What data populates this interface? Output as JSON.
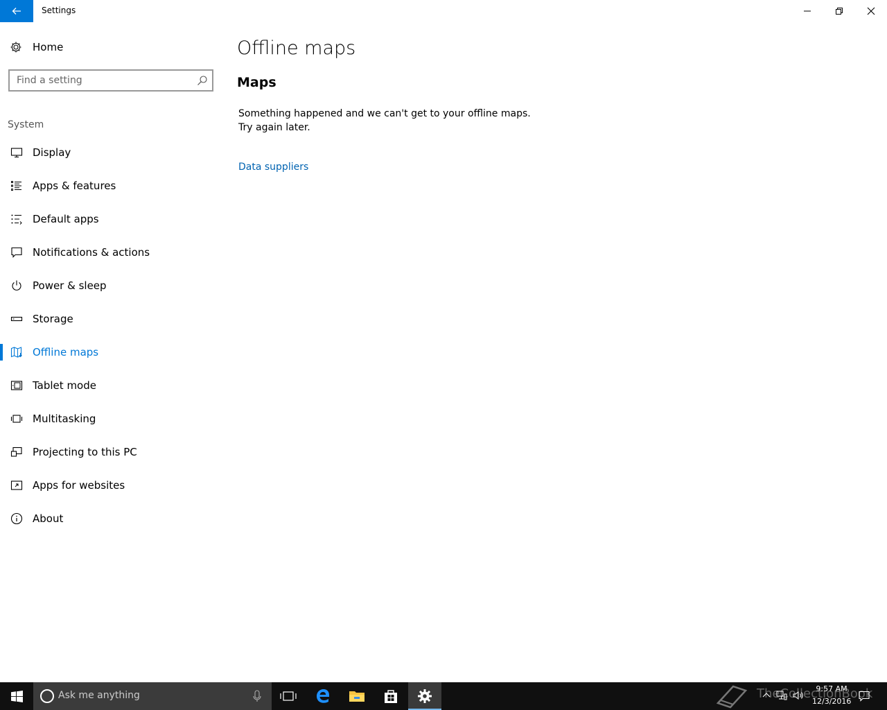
{
  "window": {
    "title": "Settings",
    "back_icon": "arrow-left-icon",
    "controls": [
      "minimize-icon",
      "maximize-icon",
      "close-icon"
    ]
  },
  "sidebar": {
    "home_label": "Home",
    "search_placeholder": "Find a setting",
    "section": "System",
    "items": [
      {
        "label": "Display",
        "icon": "display-icon",
        "active": false
      },
      {
        "label": "Apps & features",
        "icon": "apps-list-icon",
        "active": false
      },
      {
        "label": "Default apps",
        "icon": "default-apps-icon",
        "active": false
      },
      {
        "label": "Notifications & actions",
        "icon": "notifications-icon",
        "active": false
      },
      {
        "label": "Power & sleep",
        "icon": "power-icon",
        "active": false
      },
      {
        "label": "Storage",
        "icon": "storage-icon",
        "active": false
      },
      {
        "label": "Offline maps",
        "icon": "map-icon",
        "active": true
      },
      {
        "label": "Tablet mode",
        "icon": "tablet-icon",
        "active": false
      },
      {
        "label": "Multitasking",
        "icon": "multitasking-icon",
        "active": false
      },
      {
        "label": "Projecting to this PC",
        "icon": "projecting-icon",
        "active": false
      },
      {
        "label": "Apps for websites",
        "icon": "apps-websites-icon",
        "active": false
      },
      {
        "label": "About",
        "icon": "info-icon",
        "active": false
      }
    ]
  },
  "main": {
    "title": "Offline maps",
    "section_title": "Maps",
    "message": "Something happened and we can't get to your offline maps. Try again later.",
    "link": "Data suppliers"
  },
  "taskbar": {
    "search_placeholder": "Ask me anything",
    "time": "9:57 AM",
    "date": "12/3/2016"
  },
  "watermark": "TheCollectionBook",
  "colors": {
    "accent": "#0078d7",
    "link": "#0063b1",
    "taskbar": "#101010"
  }
}
